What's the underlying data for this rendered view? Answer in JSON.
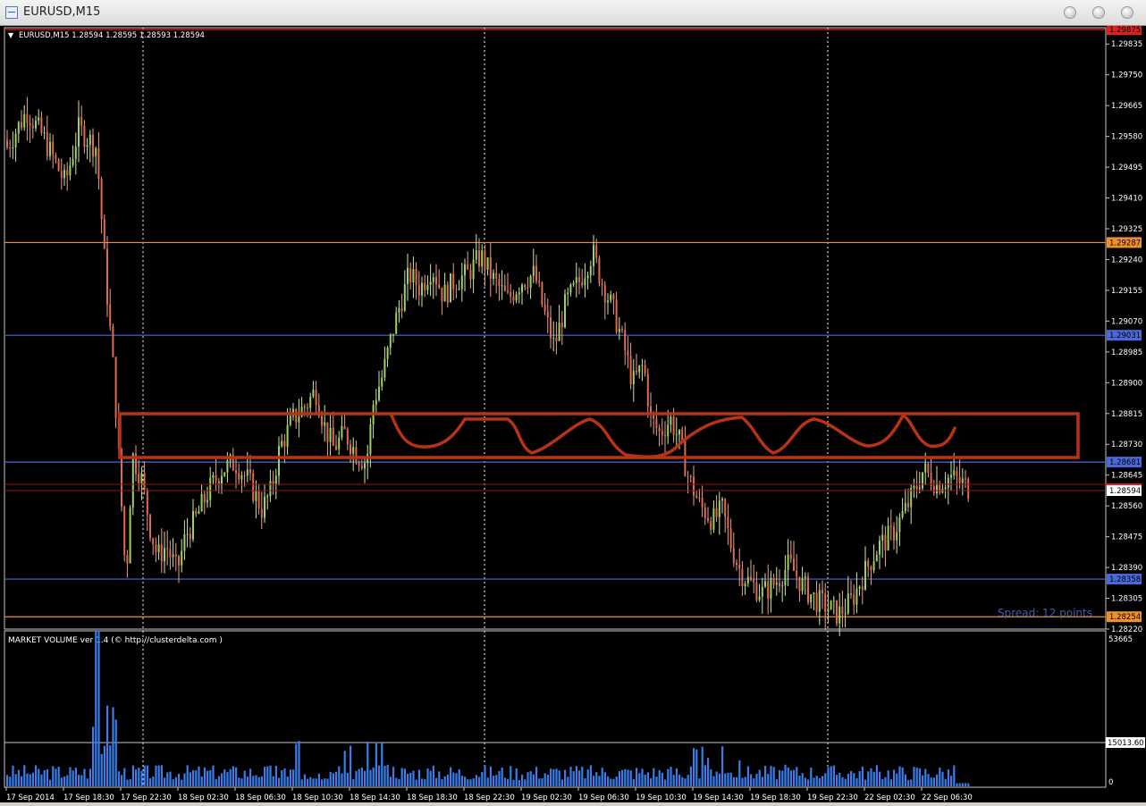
{
  "window": {
    "title": "EURUSD,M15",
    "minimize_icon": "minimize-icon",
    "restore_icon": "restore-icon",
    "close_icon": "close-icon"
  },
  "chart": {
    "header": "EURUSD,M15  1.28594 1.28595 1.28593 1.28594",
    "spread_label": "Spread: 12 points",
    "price_labels": [
      "1.29835",
      "1.29750",
      "1.29665",
      "1.29580",
      "1.29495",
      "1.29410",
      "1.29325",
      "1.29240",
      "1.29155",
      "1.29070",
      "1.28985",
      "1.28900",
      "1.28815",
      "1.28730",
      "1.28645",
      "1.28560",
      "1.28475",
      "1.28390",
      "1.28305",
      "1.28220"
    ],
    "levels": [
      {
        "price": 1.29875,
        "label": "1.29875",
        "color": "#e02020"
      },
      {
        "price": 1.29287,
        "label": "1.29287",
        "color": "#f0902a"
      },
      {
        "price": 1.29031,
        "label": "1.29031",
        "color": "#4a68d8"
      },
      {
        "price": 1.28681,
        "label": "1.28681",
        "color": "#4a68d8"
      },
      {
        "price": 1.28358,
        "label": "1.28358",
        "color": "#4a68d8"
      },
      {
        "price": 1.28254,
        "label": "1.28254",
        "color": "#f0902a"
      }
    ],
    "current_price": "1.28594",
    "time_labels": [
      "17 Sep 2014",
      "17 Sep 18:30",
      "17 Sep 22:30",
      "18 Sep 02:30",
      "18 Sep 06:30",
      "18 Sep 10:30",
      "18 Sep 14:30",
      "18 Sep 18:30",
      "18 Sep 22:30",
      "19 Sep 02:30",
      "19 Sep 06:30",
      "19 Sep 10:30",
      "19 Sep 14:30",
      "19 Sep 18:30",
      "19 Sep 22:30",
      "22 Sep 02:30",
      "22 Sep 06:30"
    ]
  },
  "volume": {
    "label": "MARKET VOLUME ver 1.4 (© http://clusterdelta.com )",
    "max_label": "53665",
    "level_label": "15013.60",
    "zero_label": "0",
    "bar_color": "#3a7ce8"
  },
  "chart_data": {
    "type": "candlestick",
    "symbol": "EURUSD",
    "timeframe": "M15",
    "ylim": [
      1.2822,
      1.2988
    ],
    "close_path": [
      [
        0,
        1.2955
      ],
      [
        22,
        1.2965
      ],
      [
        40,
        1.2958
      ],
      [
        65,
        1.2945
      ],
      [
        80,
        1.296
      ],
      [
        100,
        1.2955
      ],
      [
        110,
        1.292
      ],
      [
        120,
        1.289
      ],
      [
        127,
        1.286
      ],
      [
        133,
        1.2835
      ],
      [
        140,
        1.287
      ],
      [
        150,
        1.2864
      ],
      [
        160,
        1.285
      ],
      [
        168,
        1.2842
      ],
      [
        178,
        1.2845
      ],
      [
        190,
        1.2838
      ],
      [
        200,
        1.2848
      ],
      [
        210,
        1.2852
      ],
      [
        225,
        1.286
      ],
      [
        240,
        1.2866
      ],
      [
        255,
        1.2868
      ],
      [
        270,
        1.2863
      ],
      [
        285,
        1.2855
      ],
      [
        295,
        1.286
      ],
      [
        305,
        1.2872
      ],
      [
        320,
        1.288
      ],
      [
        335,
        1.2884
      ],
      [
        345,
        1.2888
      ],
      [
        355,
        1.2878
      ],
      [
        365,
        1.2872
      ],
      [
        378,
        1.2876
      ],
      [
        392,
        1.287
      ],
      [
        402,
        1.2868
      ],
      [
        410,
        1.2885
      ],
      [
        420,
        1.2892
      ],
      [
        432,
        1.2905
      ],
      [
        440,
        1.2912
      ],
      [
        450,
        1.292
      ],
      [
        462,
        1.2916
      ],
      [
        475,
        1.2922
      ],
      [
        488,
        1.2914
      ],
      [
        500,
        1.2918
      ],
      [
        515,
        1.292
      ],
      [
        530,
        1.2925
      ],
      [
        545,
        1.2918
      ],
      [
        560,
        1.2913
      ],
      [
        575,
        1.2918
      ],
      [
        590,
        1.292
      ],
      [
        600,
        1.291
      ],
      [
        612,
        1.29
      ],
      [
        625,
        1.2912
      ],
      [
        640,
        1.2918
      ],
      [
        655,
        1.2926
      ],
      [
        665,
        1.2918
      ],
      [
        678,
        1.291
      ],
      [
        690,
        1.29
      ],
      [
        700,
        1.289
      ],
      [
        712,
        1.2895
      ],
      [
        720,
        1.288
      ],
      [
        730,
        1.2876
      ],
      [
        742,
        1.288
      ],
      [
        752,
        1.2874
      ],
      [
        762,
        1.2864
      ],
      [
        775,
        1.2856
      ],
      [
        790,
        1.2852
      ],
      [
        800,
        1.2855
      ],
      [
        810,
        1.2845
      ],
      [
        820,
        1.2838
      ],
      [
        830,
        1.2835
      ],
      [
        845,
        1.2832
      ],
      [
        860,
        1.2835
      ],
      [
        875,
        1.284
      ],
      [
        890,
        1.2834
      ],
      [
        905,
        1.283
      ],
      [
        918,
        1.2828
      ],
      [
        930,
        1.2826
      ],
      [
        945,
        1.283
      ],
      [
        960,
        1.2838
      ],
      [
        975,
        1.2845
      ],
      [
        990,
        1.2848
      ],
      [
        1005,
        1.2855
      ],
      [
        1015,
        1.286
      ],
      [
        1025,
        1.2866
      ],
      [
        1040,
        1.2862
      ],
      [
        1055,
        1.2864
      ],
      [
        1070,
        1.2862
      ],
      [
        1085,
        1.2859
      ]
    ]
  }
}
